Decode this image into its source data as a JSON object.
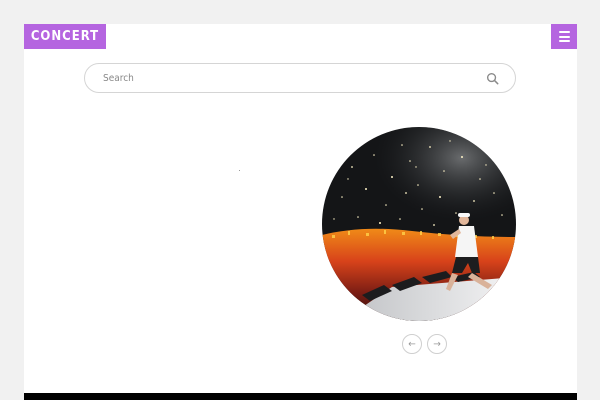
{
  "header": {
    "logo_text": "CONCERT",
    "menu_icon": "hamburger-menu-icon"
  },
  "search": {
    "placeholder": "Search",
    "value": "",
    "icon": "search-icon"
  },
  "slider": {
    "prev_symbol": "←",
    "next_symbol": "→"
  },
  "colors": {
    "accent": "#b565e0",
    "page_bg": "#f1f1f1",
    "content_bg": "#ffffff",
    "footer": "#000000"
  }
}
